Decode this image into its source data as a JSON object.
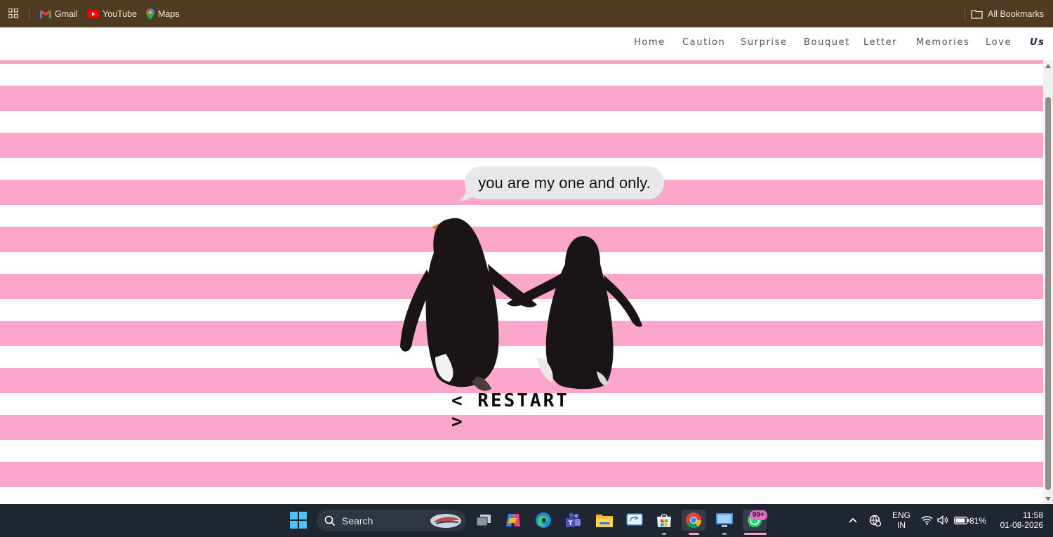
{
  "bookmarks_bar": {
    "items": [
      {
        "label": "Gmail",
        "icon": "gmail-icon"
      },
      {
        "label": "YouTube",
        "icon": "youtube-icon"
      },
      {
        "label": "Maps",
        "icon": "maps-icon"
      }
    ],
    "all_bookmarks_label": "All Bookmarks"
  },
  "nav": {
    "links": [
      "Home",
      "Caution",
      "Surprise",
      "Bouquet",
      "Letter",
      "Memories",
      "Love",
      "Us"
    ],
    "active": "Us"
  },
  "main": {
    "bubble_text": "you are my one and only.",
    "restart_label": "< RESTART >"
  },
  "taskbar": {
    "search_label": "Search",
    "whatsapp_badge": "99+",
    "language": "ENG",
    "region": "IN",
    "battery": "81%",
    "time": "11:58",
    "date": "01-08-2026"
  },
  "colors": {
    "bookmarks_bar_bg": "#4f3b21",
    "stripe_pink": "#fca6cb",
    "taskbar_bg": "#1f2631"
  }
}
